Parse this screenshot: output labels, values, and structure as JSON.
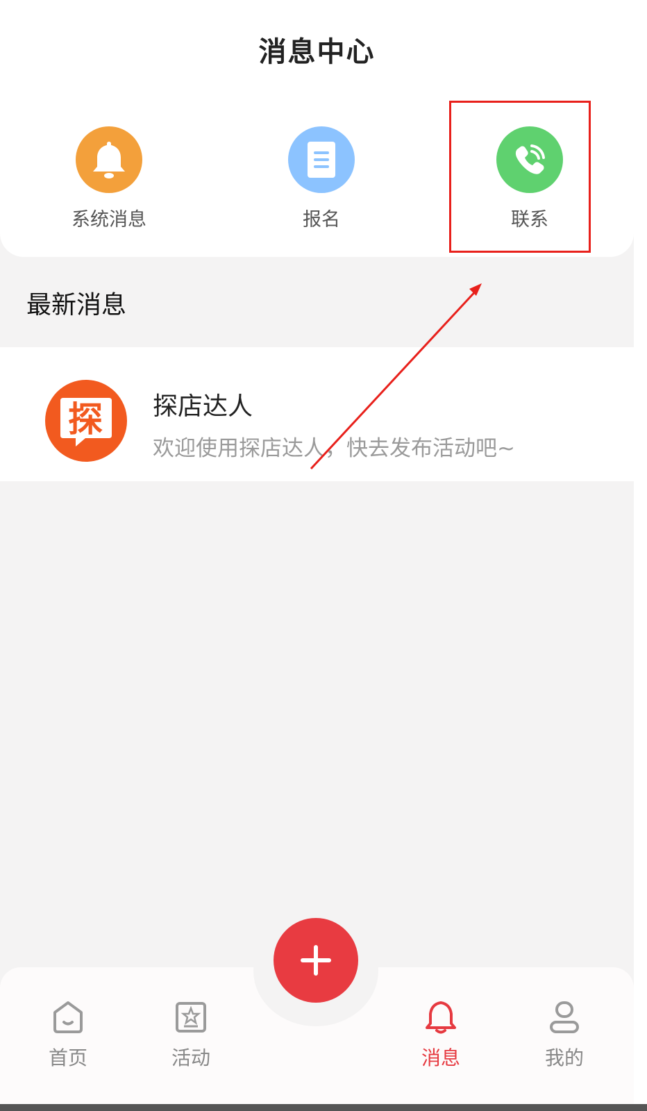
{
  "header": {
    "title": "消息中心"
  },
  "quick_actions": [
    {
      "label": "系统消息",
      "icon": "bell-icon",
      "color": "#f3a03b"
    },
    {
      "label": "报名",
      "icon": "document-icon",
      "color": "#8cc3ff"
    },
    {
      "label": "联系",
      "icon": "phone-icon",
      "color": "#5fd16f"
    }
  ],
  "latest": {
    "section_title": "最新消息",
    "items": [
      {
        "avatar_char": "探",
        "name": "探店达人",
        "preview": "欢迎使用探店达人，快去发布活动吧~"
      }
    ]
  },
  "tabbar": {
    "items": [
      {
        "label": "首页",
        "icon": "home-icon",
        "active": false
      },
      {
        "label": "活动",
        "icon": "activity-icon",
        "active": false
      },
      {
        "label": "消息",
        "icon": "bell-icon",
        "active": true
      },
      {
        "label": "我的",
        "icon": "profile-icon",
        "active": false
      }
    ],
    "fab_icon": "plus-icon"
  },
  "colors": {
    "accent": "#e63940",
    "annotation": "#e8201b"
  }
}
